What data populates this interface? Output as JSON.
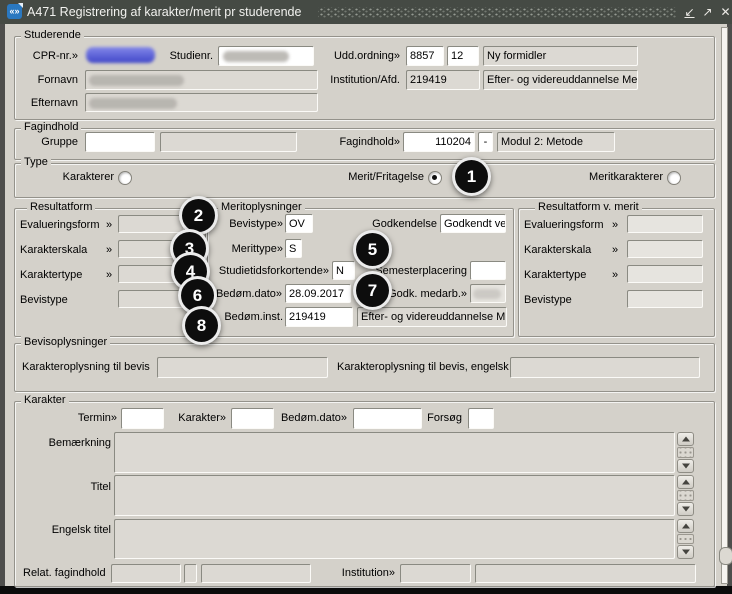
{
  "window": {
    "title": "A471 Registrering af karakter/merit pr studerende",
    "icons": {
      "app": "«»",
      "minimize": "↙",
      "maximize": "↗",
      "close": "✕"
    }
  },
  "studerende": {
    "legend": "Studerende",
    "cpr_label": "CPR-nr.»",
    "studienr_label": "Studienr.",
    "fornavn_label": "Fornavn",
    "efternavn_label": "Efternavn",
    "uddordning_label": "Udd.ordning»",
    "udd_kode": "8857",
    "udd_version": "12",
    "udd_navn": "Ny formidler",
    "institution_label": "Institution/Afd.",
    "institution_kode": "219419",
    "institution_navn": "Efter- og videreuddannelse Met"
  },
  "fagindhold": {
    "legend": "Fagindhold",
    "gruppe_label": "Gruppe",
    "fagindhold_label": "Fagindhold»",
    "kode": "110204",
    "separator": "-",
    "navn": "Modul 2: Metode"
  },
  "type": {
    "legend": "Type",
    "karakterer_label": "Karakterer",
    "merit_label": "Merit/Fritagelse",
    "meritkarakterer_label": "Meritkarakterer",
    "selected": "Merit/Fritagelse"
  },
  "resultatform": {
    "legend": "Resultatform",
    "rows": [
      {
        "label": "Evalueringsform",
        "marker": "»"
      },
      {
        "label": "Karakterskala",
        "marker": "»"
      },
      {
        "label": "Karaktertype",
        "marker": "»"
      },
      {
        "label": "Bevistype",
        "marker": ""
      }
    ]
  },
  "meritoplysninger": {
    "legend": "Meritoplysninger",
    "bevistype_label": "Bevistype»",
    "bevistype_value": "OV",
    "godkendelse_label": "Godkendelse",
    "godkendelse_value": "Godkendt ved",
    "merittype_label": "Merittype»",
    "merittype_value": "S",
    "studietidsforkortende_label": "Studietidsforkortende»",
    "studietidsforkortende_value": "N",
    "semesterplacering_label": "Semesterplacering",
    "semesterplacering_value": "",
    "bedomdato_label": "Bedøm.dato»",
    "bedomdato_value": "28.09.2017",
    "godkmedarb_label": "Godk. medarb.»",
    "bedominst_label": "Bedøm.inst.",
    "bedominst_value": "219419",
    "bedominst_navn": "Efter- og videreuddannelse M"
  },
  "resultatform_merit": {
    "legend": "Resultatform v. merit",
    "rows": [
      {
        "label": "Evalueringsform",
        "marker": "»"
      },
      {
        "label": "Karakterskala",
        "marker": "»"
      },
      {
        "label": "Karaktertype",
        "marker": "»"
      },
      {
        "label": "Bevistype",
        "marker": ""
      }
    ]
  },
  "bevisoplysninger": {
    "legend": "Bevisoplysninger",
    "bevis_label": "Karakteroplysning til bevis",
    "bevis_engelsk_label": "Karakteroplysning til bevis, engelsk"
  },
  "karakter": {
    "legend": "Karakter",
    "termin_label": "Termin»",
    "karakter_label": "Karakter»",
    "bedomdato_label": "Bedøm.dato»",
    "forsog_label": "Forsøg",
    "bemaerkning_label": "Bemærkning",
    "titel_label": "Titel",
    "engelsk_titel_label": "Engelsk titel",
    "relat_fagindhold_label": "Relat. fagindhold",
    "institution_label": "Institution»"
  },
  "badges": [
    {
      "n": "1"
    },
    {
      "n": "2"
    },
    {
      "n": "3"
    },
    {
      "n": "4"
    },
    {
      "n": "5"
    },
    {
      "n": "6"
    },
    {
      "n": "7"
    },
    {
      "n": "8"
    }
  ]
}
